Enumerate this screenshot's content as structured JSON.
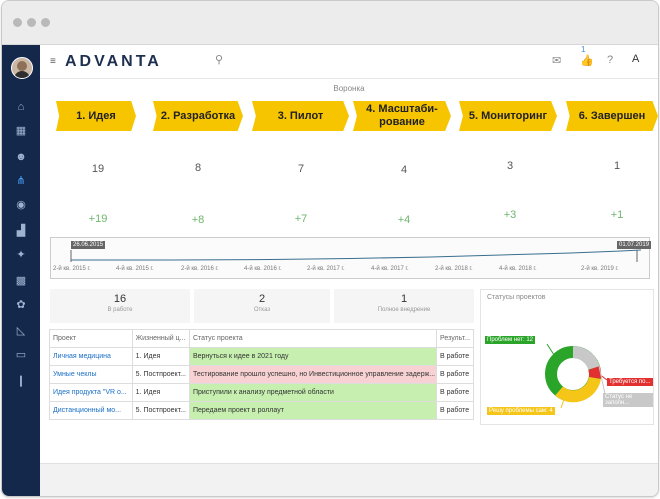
{
  "brand": {
    "logo_text": "ADVANTA"
  },
  "topbar": {
    "badge_count": "1"
  },
  "funnel": {
    "title": "Воронка",
    "stages": [
      {
        "label": "1. Идея",
        "count": "19",
        "delta": "+19"
      },
      {
        "label": "2. Разработка",
        "count": "8",
        "delta": "+8"
      },
      {
        "label": "3. Пилот",
        "count": "7",
        "delta": "+7"
      },
      {
        "label": "4. Масштаби-рование",
        "count": "4",
        "delta": "+4"
      },
      {
        "label": "5. Мониторинг",
        "count": "3",
        "delta": "+3"
      },
      {
        "label": "6. Завершен",
        "count": "1",
        "delta": "+1"
      }
    ]
  },
  "timeline": {
    "start_tag": "26.06.2015",
    "end_tag": "01.07.2019",
    "labels": [
      "2-й кв. 2015 г.",
      "4-й кв. 2015 г.",
      "2-й кв. 2016 г.",
      "4-й кв. 2016 г.",
      "2-й кв. 2017 г.",
      "4-й кв. 2017 г.",
      "2-й кв. 2018 г.",
      "4-й кв. 2018 г.",
      "2-й кв. 2019 г."
    ]
  },
  "stats": [
    {
      "value": "16",
      "label": "В работе"
    },
    {
      "value": "2",
      "label": "Отказ"
    },
    {
      "value": "1",
      "label": "Полное внедрение"
    }
  ],
  "table": {
    "headers": [
      "Проект",
      "Жизненный ц...",
      "Статус проекта",
      "Результ..."
    ],
    "rows": [
      {
        "project": "Личная медицина",
        "stage": "1. Идея",
        "status": "Вернуться к идее в 2021 году",
        "result": "В работе",
        "color": "#c6efb0"
      },
      {
        "project": "Умные чеклы",
        "stage": "5. Постпроект...",
        "status": "Тестирование прошло успешно, но Инвестиционное управление задерж...",
        "result": "В работе",
        "color": "#f8d2d2"
      },
      {
        "project": "Идея продукта \"VR o...",
        "stage": "1. Идея",
        "status": "Приступили к анализу предметной области",
        "result": "В работе",
        "color": "#c6efb0"
      },
      {
        "project": "Дистанционный мо...",
        "stage": "5. Постпроект...",
        "status": "Передаем проект в роллаут",
        "result": "В работе",
        "color": "#c6efb0"
      }
    ]
  },
  "donut": {
    "title": "Статусы проектов",
    "label_no_problems": "Проблем нет: 12",
    "label_required": "Требуется по...",
    "label_not_set": "Статус не заполн...",
    "label_solvable": "Решу проблемы сам: 4",
    "colors": {
      "green": "#2aa52a",
      "yellow": "#f5c518",
      "red": "#e23030",
      "grey": "#c8c8c8"
    }
  }
}
